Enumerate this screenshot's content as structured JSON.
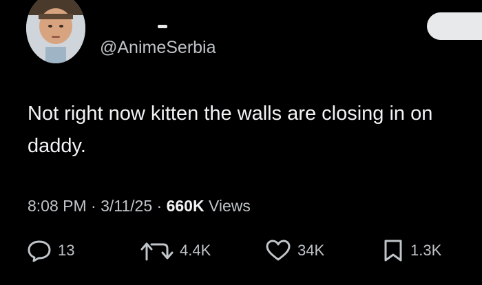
{
  "author": {
    "handle": "@AnimeSerbia"
  },
  "tweet": {
    "text": "Not right now kitten the walls are closing in on\ndaddy."
  },
  "meta": {
    "time": "8:08 PM",
    "separator1": "·",
    "date": "3/11/25",
    "separator2": "·",
    "views_count": "660K",
    "views_label": "Views"
  },
  "actions": {
    "replies": {
      "icon": "reply-icon",
      "count": "13"
    },
    "reposts": {
      "icon": "repost-icon",
      "count": "4.4K"
    },
    "likes": {
      "icon": "heart-icon",
      "count": "34K"
    },
    "bookmarks": {
      "icon": "bookmark-icon",
      "count": "1.3K"
    }
  },
  "colors": {
    "background": "#000000",
    "text_primary": "#f1f3f4",
    "text_secondary": "#c0c5c9",
    "button": "#e7e9ea"
  }
}
